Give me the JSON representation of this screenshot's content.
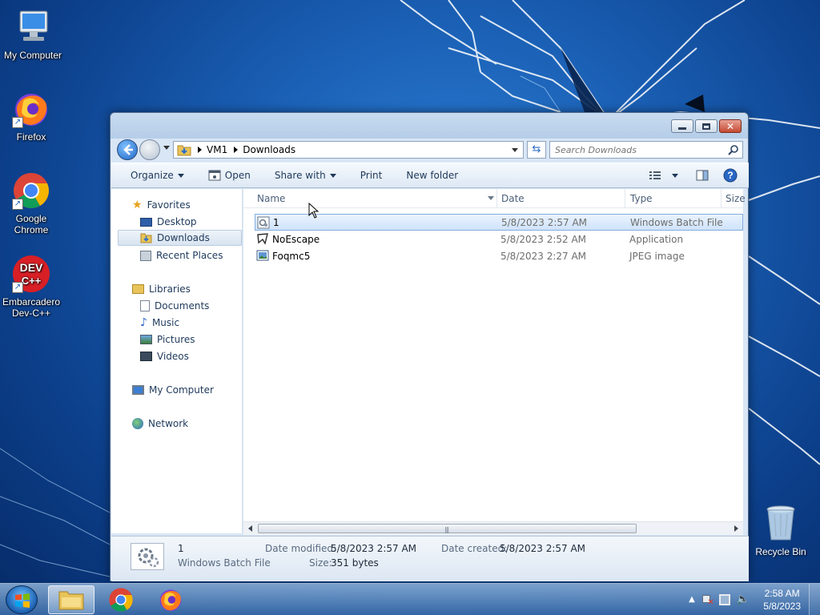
{
  "desktop": {
    "icons": [
      {
        "label": "My Computer"
      },
      {
        "label": "Firefox"
      },
      {
        "label": "Google Chrome"
      },
      {
        "label": "Embarcadero Dev-C++"
      }
    ],
    "recycle_bin": "Recycle Bin"
  },
  "window": {
    "breadcrumb": [
      "VM1",
      "Downloads"
    ],
    "search_placeholder": "Search Downloads",
    "commands": {
      "organize": "Organize",
      "open": "Open",
      "share_with": "Share with",
      "print": "Print",
      "new_folder": "New folder"
    },
    "nav": {
      "favorites": "Favorites",
      "desktop": "Desktop",
      "downloads": "Downloads",
      "recent_places": "Recent Places",
      "libraries": "Libraries",
      "documents": "Documents",
      "music": "Music",
      "pictures": "Pictures",
      "videos": "Videos",
      "my_computer": "My Computer",
      "network": "Network"
    },
    "columns": {
      "name": "Name",
      "date": "Date",
      "type": "Type",
      "size": "Size"
    },
    "files": [
      {
        "name": "1",
        "date": "5/8/2023 2:57 AM",
        "type": "Windows Batch File"
      },
      {
        "name": "NoEscape",
        "date": "5/8/2023 2:52 AM",
        "type": "Application"
      },
      {
        "name": "Foqmc5",
        "date": "5/8/2023 2:27 AM",
        "type": "JPEG image"
      }
    ],
    "details": {
      "name": "1",
      "type": "Windows Batch File",
      "date_modified_label": "Date modified:",
      "date_modified": "5/8/2023 2:57 AM",
      "date_created_label": "Date created:",
      "date_created": "5/8/2023 2:57 AM",
      "size_label": "Size:",
      "size": "351 bytes"
    }
  },
  "taskbar": {
    "time": "2:58 AM",
    "date": "5/8/2023"
  },
  "colors": {
    "selection": "#cfe3fb",
    "accent": "#1a5fb4"
  }
}
